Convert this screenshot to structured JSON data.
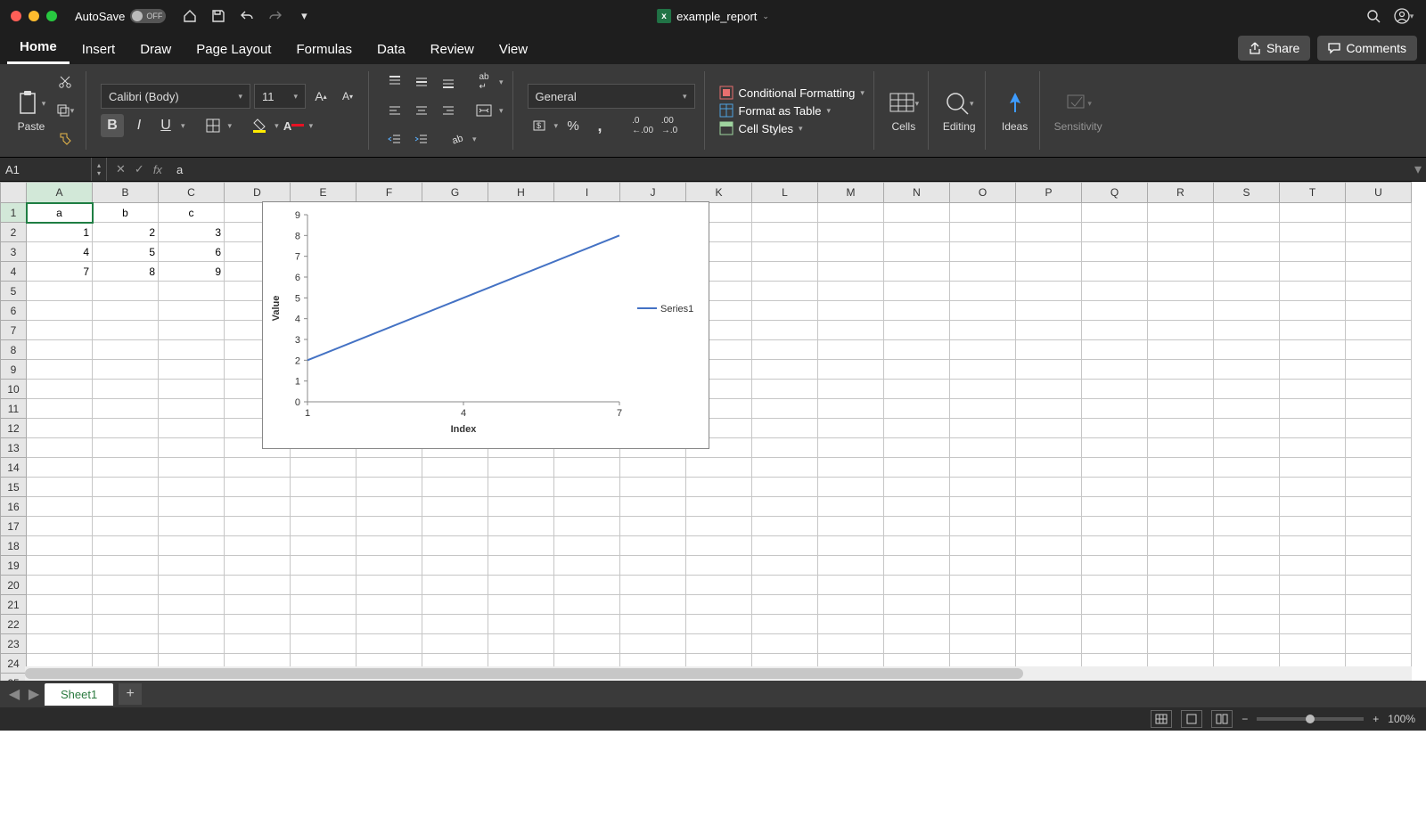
{
  "title_bar": {
    "autosave_label": "AutoSave",
    "autosave_state": "OFF",
    "filename": "example_report"
  },
  "tabs": {
    "items": [
      "Home",
      "Insert",
      "Draw",
      "Page Layout",
      "Formulas",
      "Data",
      "Review",
      "View"
    ],
    "active": "Home",
    "share": "Share",
    "comments": "Comments"
  },
  "ribbon": {
    "paste": "Paste",
    "font_name": "Calibri (Body)",
    "font_size": "11",
    "number_format": "General",
    "cond_fmt": "Conditional Formatting",
    "fmt_table": "Format as Table",
    "cell_styles": "Cell Styles",
    "cells": "Cells",
    "editing": "Editing",
    "ideas": "Ideas",
    "sensitivity": "Sensitivity"
  },
  "formula_bar": {
    "namebox": "A1",
    "value": "a"
  },
  "grid": {
    "columns": [
      "A",
      "B",
      "C",
      "D",
      "E",
      "F",
      "G",
      "H",
      "I",
      "J",
      "K",
      "L",
      "M",
      "N",
      "O",
      "P",
      "Q",
      "R",
      "S",
      "T",
      "U"
    ],
    "rows": 28,
    "active_cell": "A1",
    "data": {
      "A1": "a",
      "B1": "b",
      "C1": "c",
      "A2": "1",
      "B2": "2",
      "C2": "3",
      "A3": "4",
      "B3": "5",
      "C3": "6",
      "A4": "7",
      "B4": "8",
      "C4": "9"
    }
  },
  "sheet_tabs": {
    "active": "Sheet1"
  },
  "status": {
    "zoom": "100%"
  },
  "chart_data": {
    "type": "line",
    "x": [
      1,
      4,
      7
    ],
    "series": [
      {
        "name": "Series1",
        "values": [
          2,
          5,
          8
        ]
      }
    ],
    "xlabel": "Index",
    "ylabel": "Value",
    "xlim": [
      1,
      7
    ],
    "ylim": [
      0,
      9
    ],
    "xticks": [
      1,
      4,
      7
    ],
    "yticks": [
      0,
      1,
      2,
      3,
      4,
      5,
      6,
      7,
      8,
      9
    ]
  }
}
